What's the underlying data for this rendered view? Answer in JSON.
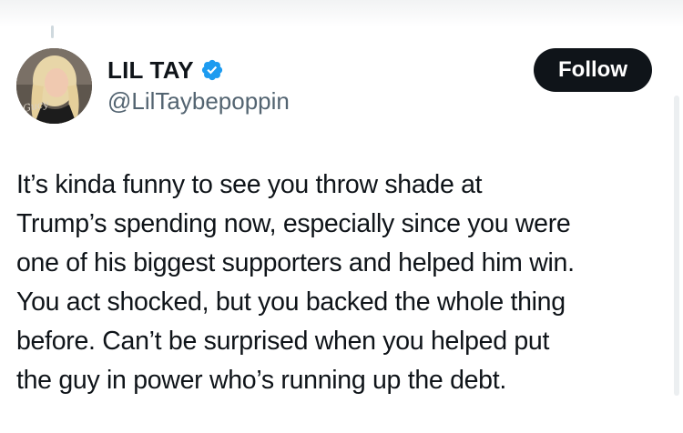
{
  "author": {
    "display_name": "LIL TAY",
    "handle": "@LilTaybepoppin",
    "verified": true
  },
  "follow_label": "Follow",
  "tweet": {
    "lines": [
      "It’s kinda funny to see you throw shade at",
      "Trump’s spending now, especially since you were",
      "one of his biggest supporters and helped him win.",
      "You act shocked, but you backed the whole thing",
      "before. Can’t be surprised when you helped put",
      "the guy in power who’s running up the debt."
    ]
  },
  "icons": {
    "verified": "verified-badge-icon",
    "avatar": "profile-photo"
  },
  "colors": {
    "verified_blue": "#1d9bf0",
    "follow_button_bg": "#0f1419",
    "handle_gray": "#536471"
  }
}
